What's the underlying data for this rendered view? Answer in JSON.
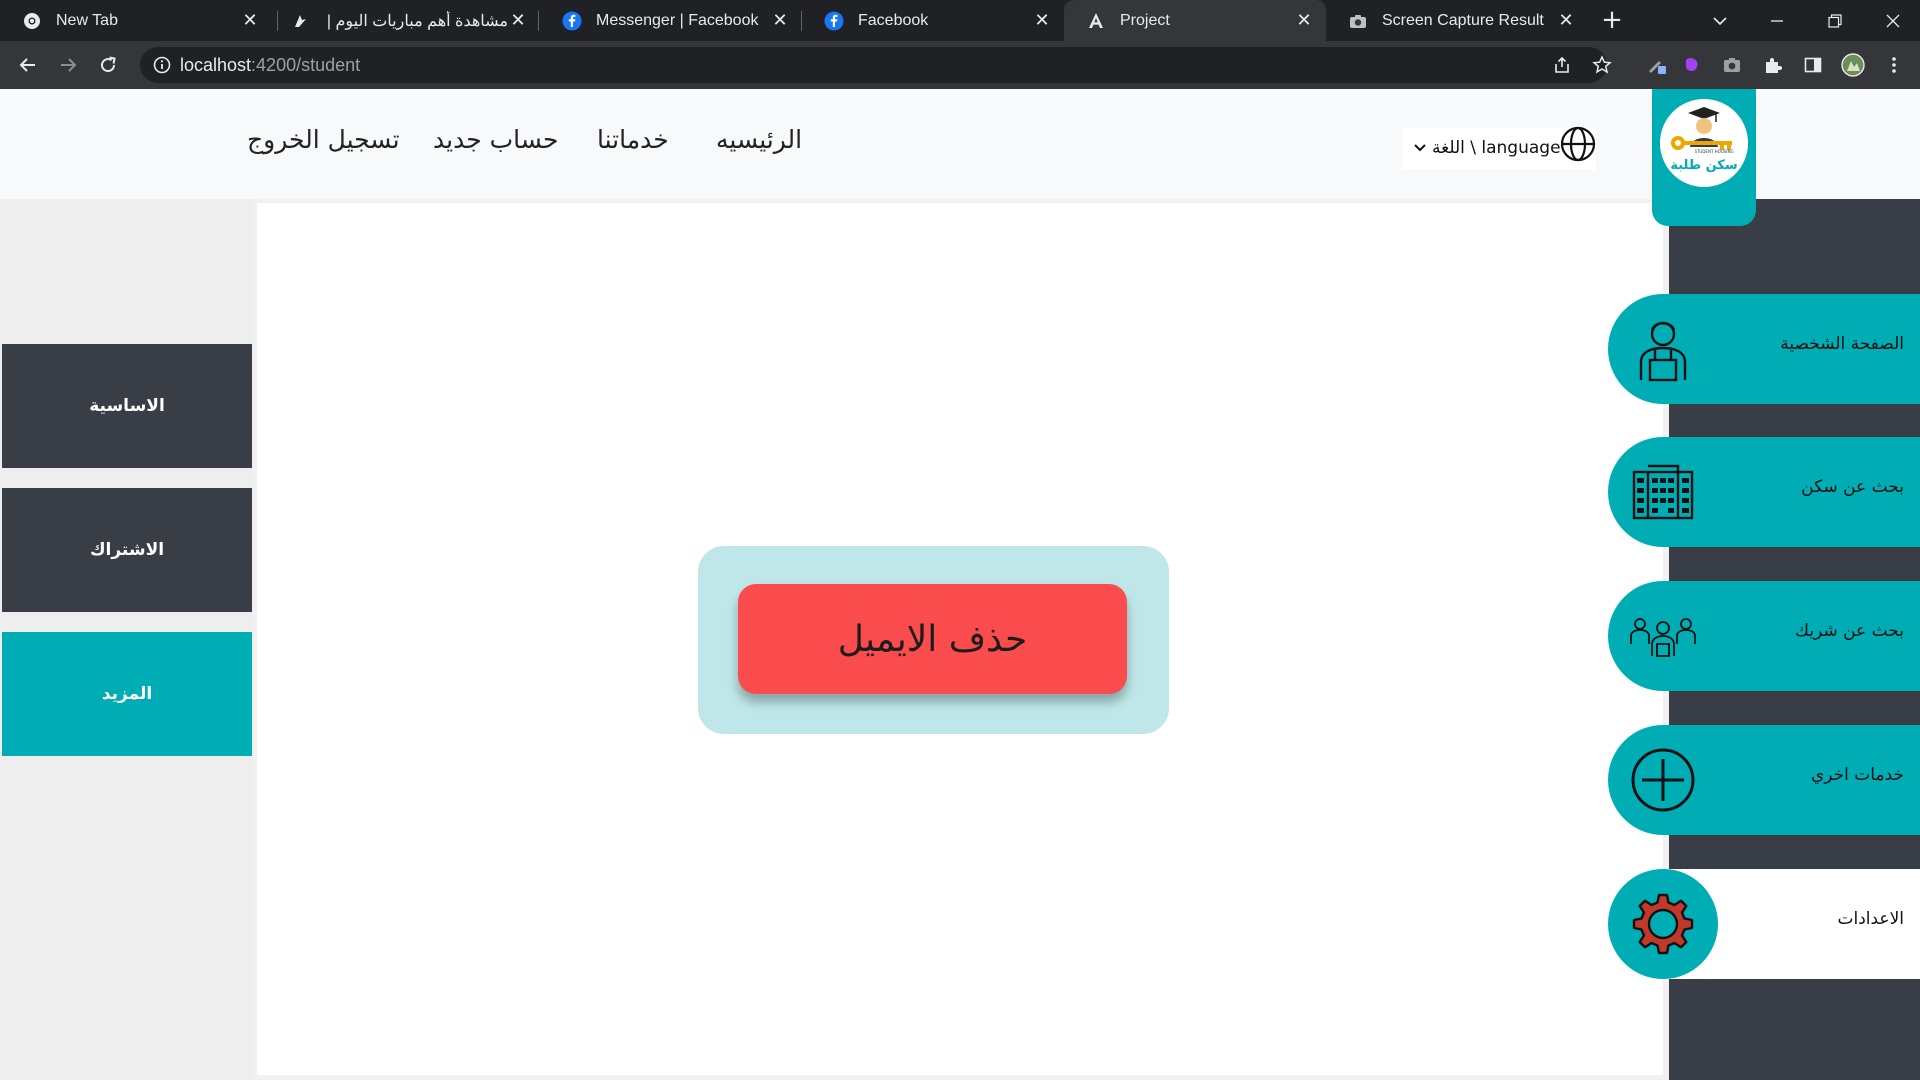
{
  "browser": {
    "tabs": [
      {
        "title": "New Tab",
        "icon": "chrome-icon"
      },
      {
        "title": "مشاهدة أهم مباريات اليوم | أ",
        "icon": "sports-icon"
      },
      {
        "title": "Messenger | Facebook",
        "icon": "facebook-icon"
      },
      {
        "title": "Facebook",
        "icon": "facebook-icon"
      },
      {
        "title": "Project",
        "icon": "angular-icon",
        "active": true
      },
      {
        "title": "Screen Capture Result",
        "icon": "camera-icon"
      }
    ],
    "close_glyph": "✕",
    "new_tab_glyph": "+",
    "url_host": "localhost",
    "url_rest": ":4200/student"
  },
  "header": {
    "nav": {
      "home": "الرئيسيه",
      "services": "خدماتنا",
      "register": "حساب جديد",
      "logout": "تسجيل الخروج"
    },
    "language_label": "اللغة \\ language",
    "logo_text": "سكن طلبة",
    "logo_subtext": "STUDENT HOUSING"
  },
  "left_menu": {
    "items": [
      {
        "label": "الاساسية",
        "state": "default"
      },
      {
        "label": "الاشتراك",
        "state": "default"
      },
      {
        "label": "المزيد",
        "state": "active"
      }
    ]
  },
  "right_menu": {
    "items": [
      {
        "label": "الصفحة الشخصية",
        "icon": "student-profile-icon"
      },
      {
        "label": "بحث عن سكن",
        "icon": "buildings-icon"
      },
      {
        "label": "بحث عن شريك",
        "icon": "group-icon"
      },
      {
        "label": "خدمات اخري",
        "icon": "plus-circle-icon"
      },
      {
        "label": "الاعدادات",
        "icon": "gear-icon",
        "active": true
      }
    ]
  },
  "main": {
    "delete_email_label": "حذف الايميل"
  },
  "colors": {
    "teal": "#00adb5",
    "dark": "#393e46",
    "danger": "#fa4c4c",
    "danger_wrap": "#bfe6e8"
  }
}
